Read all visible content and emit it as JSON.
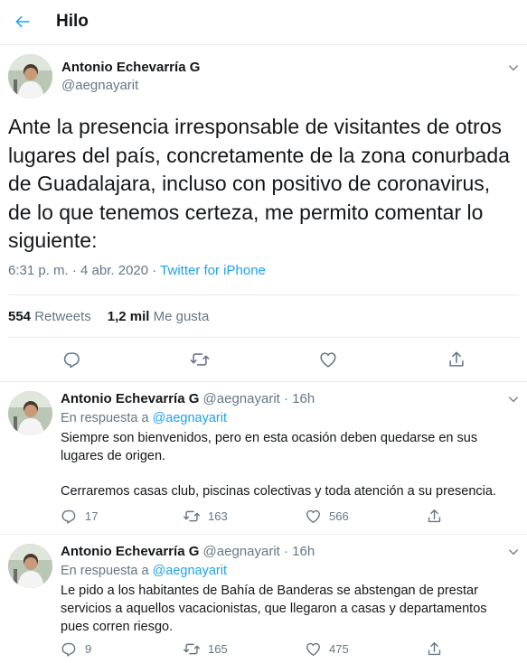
{
  "header": {
    "title": "Hilo",
    "back_icon": "arrow-left-icon",
    "accent": "#1da1f2"
  },
  "main_tweet": {
    "author": "Antonio Echevarría G",
    "handle": "@aegnayarit",
    "text": "Ante la presencia irresponsable de visitantes de otros lugares del país, concretamente de la zona conurbada de Guadalajara, incluso con positivo de coronavirus, de lo que tenemos certeza,  me permito comentar lo siguiente:",
    "timestamp": "6:31 p. m. · 4 abr. 2020 · ",
    "source": "Twitter for iPhone",
    "retweets_count": "554",
    "retweets_label": "Retweets",
    "likes_count": "1,2 mil",
    "likes_label": "Me gusta"
  },
  "replies": [
    {
      "author": "Antonio Echevarría G",
      "handle": "@aegnayarit · 16h",
      "reply_to_prefix": "En respuesta a ",
      "reply_to_handle": "@aegnayarit",
      "text_lines": [
        "Siempre son bienvenidos, pero en esta ocasión deben quedarse en sus lugares de origen.",
        "Cerraremos casas club, piscinas colectivas y toda atención a su presencia."
      ],
      "replies": "17",
      "retweets": "163",
      "likes": "566"
    },
    {
      "author": "Antonio Echevarría G",
      "handle": "@aegnayarit · 16h",
      "reply_to_prefix": "En respuesta a ",
      "reply_to_handle": "@aegnayarit",
      "text_lines": [
        "Le pido a los habitantes de Bahía de Banderas se abstengan de prestar servicios a aquellos vacacionistas, que llegaron a casas y departamentos pues corren riesgo."
      ],
      "replies": "9",
      "retweets": "165",
      "likes": "475"
    }
  ]
}
